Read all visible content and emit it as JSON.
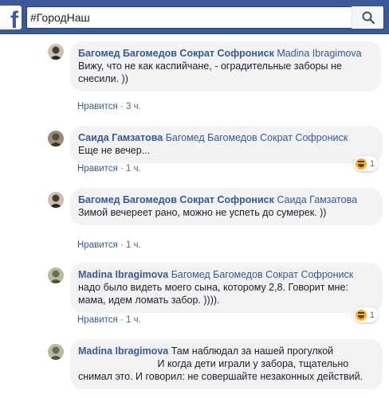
{
  "header": {
    "logo": "f",
    "search_value": "#ГородНаш",
    "search_icon": "search-icon",
    "brand_color": "#3b5998"
  },
  "comments": [
    {
      "author": "Багомед Багомедов Сократ Софрониск",
      "mention": "Madina Ibragimova",
      "text": "Вижу, что не как каспийчане, - оградительные заборы не снесили. ))",
      "like_label": "Нравится",
      "time": "3 ч."
    },
    {
      "author": "Саида Гамзатова",
      "mention": "Багомед Багомедов Сократ Софрониск",
      "text": "Еще не вечер...",
      "like_label": "Нравится",
      "time": "1 ч.",
      "reaction_count": "1"
    },
    {
      "author": "Багомед Багомедов Сократ Софрониск",
      "mention": "Саида Гамзатова",
      "text": "Зимой вечереет рано, можно не успеть до сумерек. ))",
      "like_label": "Нравится",
      "time": "1 ч."
    },
    {
      "author": "Madina Ibragimova",
      "mention": "Багомед Багомедов Сократ Софрониск",
      "text": "надо было видеть моего сына, которому 2,8. Говорит мне: мама, идем ломать забор. )))).",
      "like_label": "Нравится",
      "time": "1 ч.",
      "reaction_count": "1"
    },
    {
      "author": "Madina Ibragimova",
      "text_part1": "Там наблюдал за нашей прогулкой",
      "text_part2": "И когда дети играли у забора, тщательно снимал это. И говорил: не совершайте незаконных действий."
    }
  ]
}
